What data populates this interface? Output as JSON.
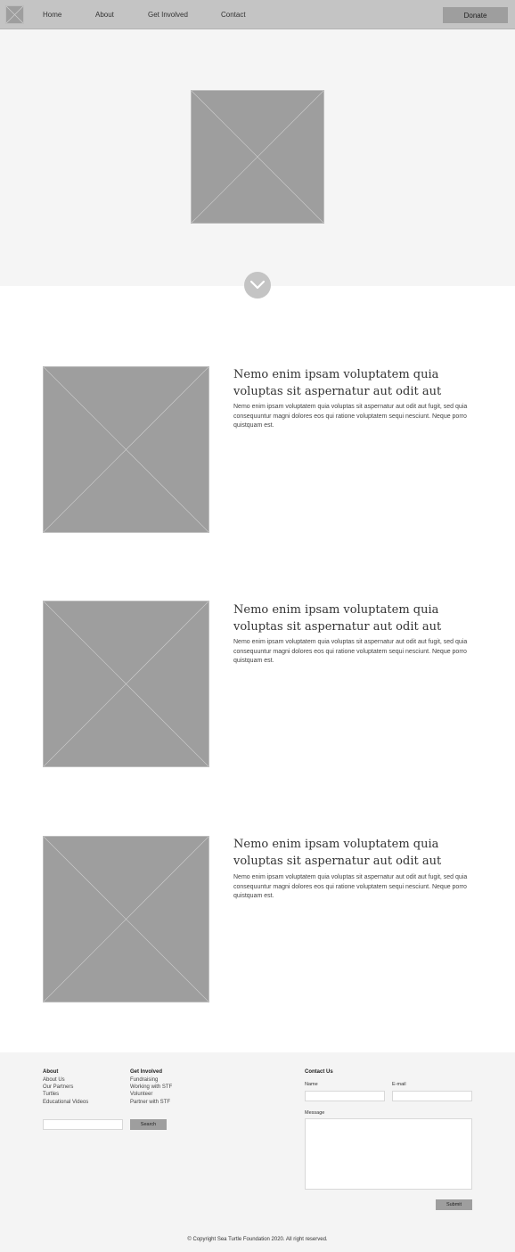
{
  "nav": {
    "links": [
      {
        "label": "Home"
      },
      {
        "label": "About"
      },
      {
        "label": "Get Involved"
      },
      {
        "label": "Contact"
      }
    ],
    "donate_label": "Donate"
  },
  "blocks": [
    {
      "title": "Nemo enim ipsam voluptatem quia voluptas sit aspernatur aut odit aut",
      "text": "Nemo enim ipsam voluptatem quia voluptas sit aspernatur aut odit aut fugit, sed quia consequuntur magni dolores eos qui ratione voluptatem sequi nesciunt. Neque porro quistquam est."
    },
    {
      "title": "Nemo enim ipsam voluptatem quia voluptas sit aspernatur aut odit aut",
      "text": "Nemo enim ipsam voluptatem quia voluptas sit aspernatur aut odit aut fugit, sed quia consequuntur magni dolores eos qui ratione voluptatem sequi nesciunt. Neque porro quistquam est."
    },
    {
      "title": "Nemo enim ipsam voluptatem quia voluptas sit aspernatur aut odit aut",
      "text": "Nemo enim ipsam voluptatem quia voluptas sit aspernatur aut odit aut fugit, sed quia consequuntur magni dolores eos qui ratione voluptatem sequi nesciunt. Neque porro quistquam est."
    }
  ],
  "footer": {
    "about": {
      "heading": "About",
      "links": [
        "About Us",
        "Our Partners",
        "Turtles",
        "Educational Videos"
      ]
    },
    "involved": {
      "heading": "Get Involved",
      "links": [
        "Fundraising",
        "Working with STF",
        "Volunteer",
        "Partner with STF"
      ]
    },
    "search": {
      "value": "",
      "button_label": "Search"
    },
    "contact": {
      "heading": "Contact Us",
      "name_label": "Name",
      "email_label": "E-mail",
      "message_label": "Message",
      "submit_label": "Submit"
    },
    "copyright": "© Copyright Sea Turtle Foundation 2020. All right reserved."
  },
  "icons": {
    "logo": "logo-placeholder-icon",
    "scroll": "chevron-down-icon"
  },
  "colors": {
    "nav_bg": "#c4c4c4",
    "placeholder": "#9e9e9e",
    "hero_bg": "#f5f5f5",
    "footer_bg": "#f4f4f4"
  }
}
